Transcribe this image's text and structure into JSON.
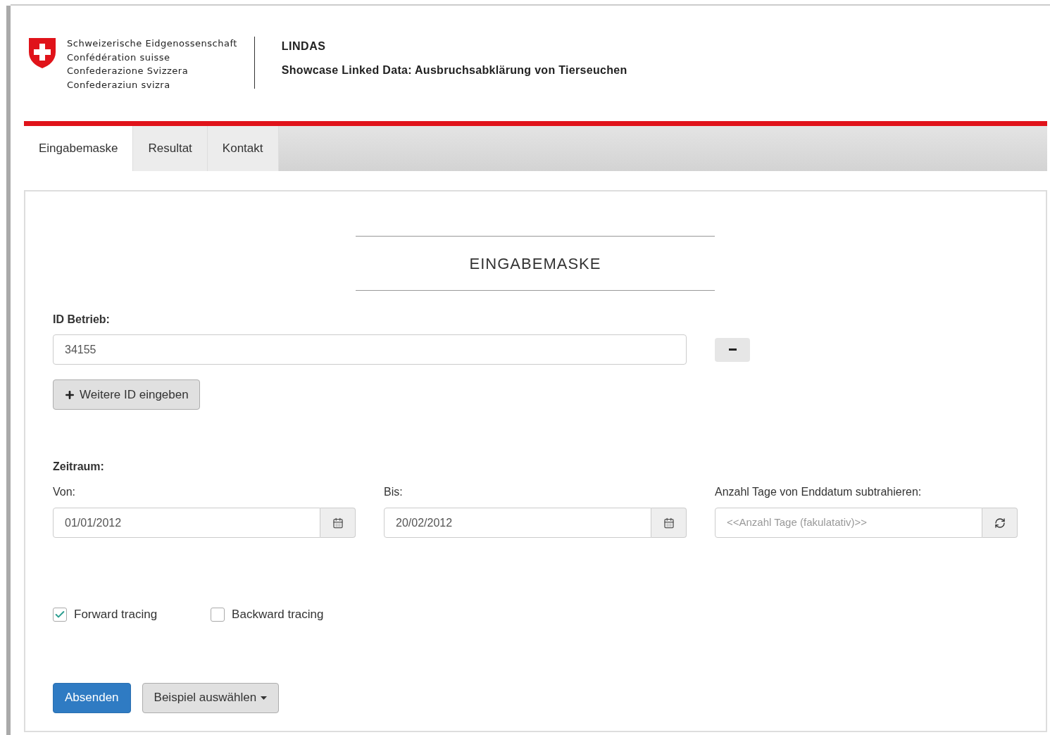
{
  "header": {
    "federation_lines": [
      "Schweizerische Eidgenossenschaft",
      "Confédération suisse",
      "Confederazione Svizzera",
      "Confederaziun svizra"
    ],
    "site_title": "LINDAS",
    "subtitle": "Showcase Linked Data: Ausbruchsabklärung von Tierseuchen"
  },
  "tabs": [
    {
      "label": "Eingabemaske",
      "selected": true
    },
    {
      "label": "Resultat",
      "selected": false
    },
    {
      "label": "Kontakt",
      "selected": false
    }
  ],
  "form": {
    "heading": "EINGABEMASKE",
    "id_label": "ID Betrieb:",
    "id_value": "34155",
    "add_id_button": "Weitere ID eingeben",
    "period_label": "Zeitraum:",
    "from_label": "Von:",
    "from_value": "01/01/2012",
    "to_label": "Bis:",
    "to_value": "20/02/2012",
    "days_label": "Anzahl Tage von Enddatum subtrahieren:",
    "days_placeholder": "<<Anzahl Tage (fakulatativ)>>",
    "options": [
      {
        "label": "Forward tracing",
        "checked": true
      },
      {
        "label": "Backward tracing",
        "checked": false
      }
    ],
    "submit_button": "Absenden",
    "example_button": "Beispiel auswählen"
  }
}
